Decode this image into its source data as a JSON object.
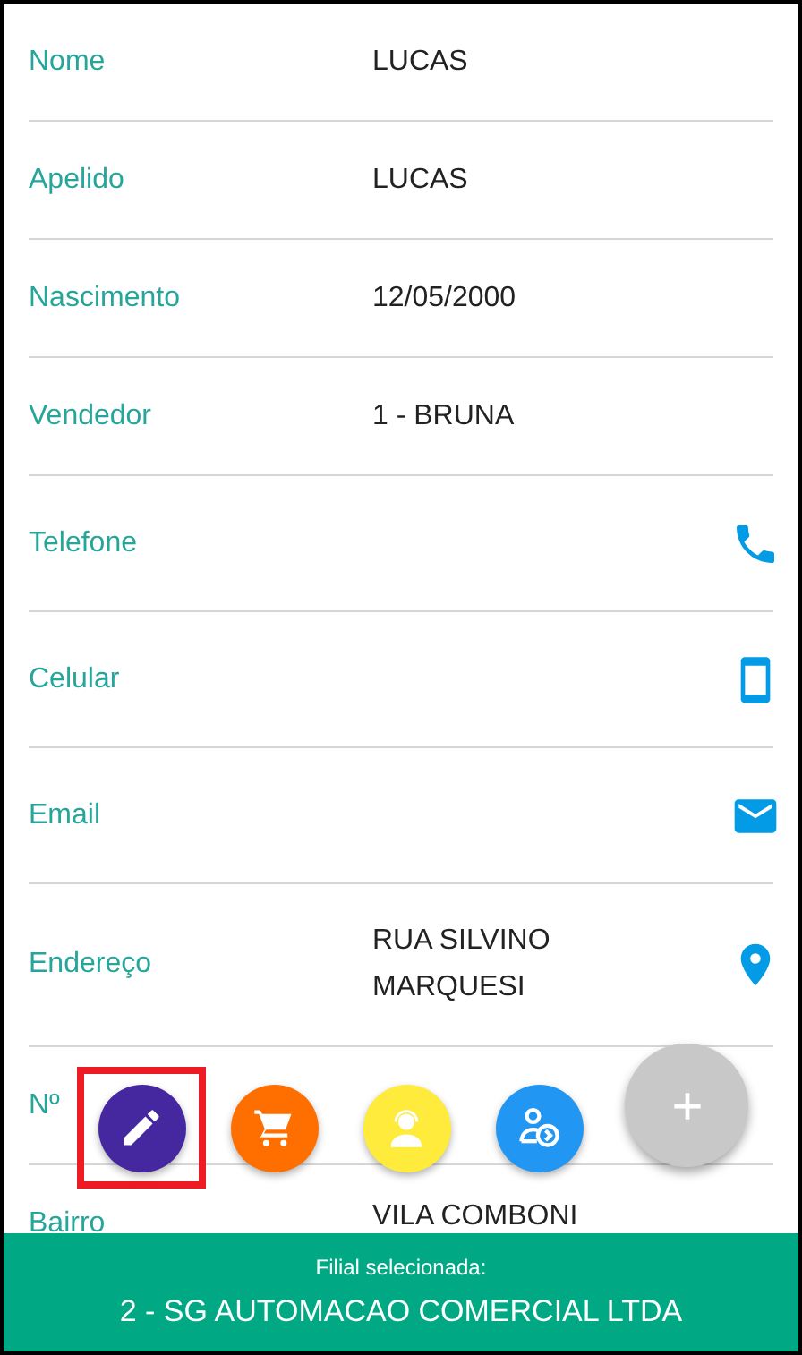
{
  "fields": [
    {
      "kind": "text",
      "label": "Nome",
      "value": "LUCAS"
    },
    {
      "kind": "text",
      "label": "Apelido",
      "value": "LUCAS"
    },
    {
      "kind": "text",
      "label": "Nascimento",
      "value": "12/05/2000"
    },
    {
      "kind": "text",
      "label": "Vendedor",
      "value": "1 - BRUNA"
    },
    {
      "kind": "phone",
      "label": "Telefone"
    },
    {
      "kind": "mobile",
      "label": "Celular"
    },
    {
      "kind": "email",
      "label": "Email"
    },
    {
      "kind": "location",
      "label": "Endereço",
      "value": "RUA SILVINO MARQUESI"
    },
    {
      "kind": "text",
      "label": "Nº"
    },
    {
      "kind": "text",
      "label": "Bairro",
      "value": "VILA COMBONI"
    }
  ],
  "actions": [
    {
      "kind": "edit",
      "color": "#4527a0",
      "highlighted": true
    },
    {
      "kind": "cart",
      "color": "#ff6f00",
      "highlighted": false
    },
    {
      "kind": "support",
      "color": "#ffeb3b",
      "highlighted": false
    },
    {
      "kind": "user",
      "color": "#2196f3",
      "highlighted": false
    }
  ],
  "main_action": {
    "kind": "add"
  },
  "footer": {
    "caption": "Filial selecionada:",
    "branch": "2 - SG AUTOMACAO COMERCIAL LTDA"
  }
}
